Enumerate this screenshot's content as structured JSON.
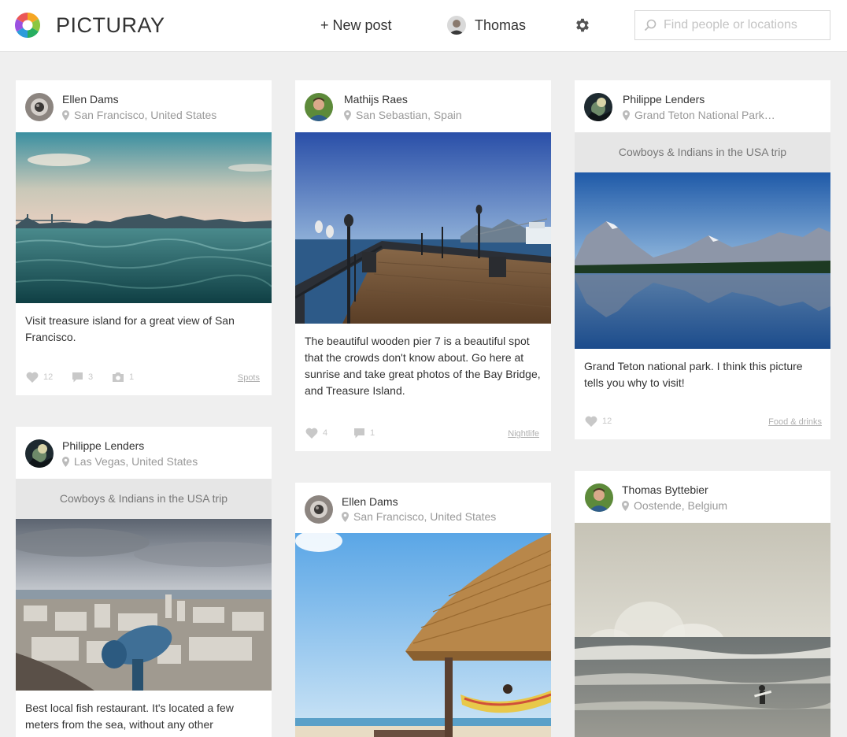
{
  "header": {
    "brand": "PICTURAY",
    "new_post": "+ New post",
    "user_name": "Thomas",
    "search_placeholder": "Find people or locations"
  },
  "icons": [
    "logo-icon",
    "avatar",
    "gear-icon",
    "search-icon",
    "location-pin-icon",
    "heart-icon",
    "comment-icon",
    "camera-icon"
  ],
  "colors": {
    "background": "#efefef",
    "card": "#ffffff",
    "text": "#333333",
    "muted": "#999999",
    "stat": "#c8c8c8",
    "trip_banner": "#e6e6e6"
  },
  "posts": [
    {
      "author": "Ellen Dams",
      "location": "San Francisco, United States",
      "caption": "Visit treasure island for a great view of San Francisco.",
      "likes": "12",
      "comments": "3",
      "photos": "1",
      "tag": "Spots"
    },
    {
      "author": "Mathijs Raes",
      "location": "San Sebastian, Spain",
      "caption": "The beautiful wooden pier 7 is a beautiful spot that the crowds don't know about. Go here at sunrise and take great photos of the Bay Bridge, and Treasure Island.",
      "likes": "4",
      "comments": "1",
      "tag": "Nightlife"
    },
    {
      "author": "Philippe Lenders",
      "location": "Grand Teton National Park…",
      "trip": "Cowboys & Indians in the USA trip",
      "caption": "Grand Teton national park. I think this picture tells you why to visit!",
      "likes": "12",
      "tag": "Food & drinks"
    },
    {
      "author": "Philippe Lenders",
      "location": "Las Vegas, United States",
      "trip": "Cowboys & Indians in the USA trip",
      "caption": "Best local fish restaurant. It's located a few meters from the sea, without any other"
    },
    {
      "author": "Ellen Dams",
      "location": "San Francisco, United States"
    },
    {
      "author": "Thomas Byttebier",
      "location": "Oostende, Belgium"
    }
  ]
}
